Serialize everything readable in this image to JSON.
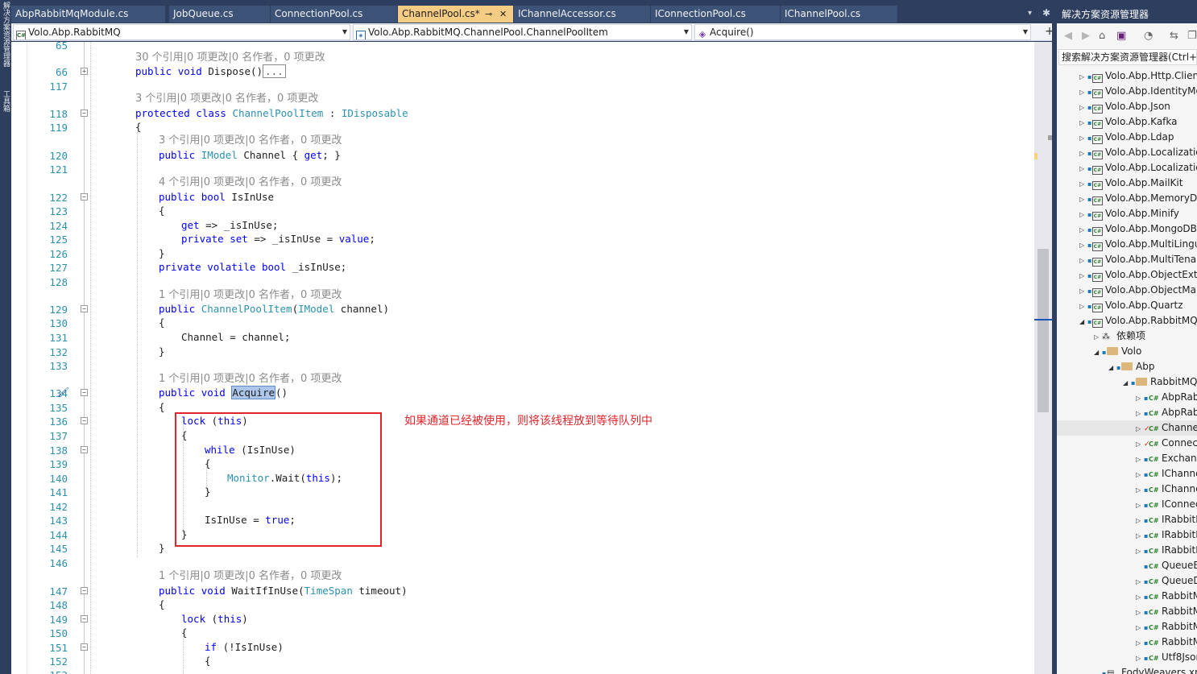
{
  "left_strip": {
    "labels": [
      "解决方案资源管理器",
      "工具箱"
    ]
  },
  "tabs": [
    {
      "label": "AbpRabbitMqModule.cs"
    },
    {
      "label": "JobQueue.cs"
    },
    {
      "label": "ConnectionPool.cs"
    },
    {
      "label": "ChannelPool.cs*",
      "active": true,
      "pin": "⊸",
      "close": "✕"
    },
    {
      "label": "IChannelAccessor.cs"
    },
    {
      "label": "IConnectionPool.cs"
    },
    {
      "label": "IChannelPool.cs"
    }
  ],
  "tab_controls": {
    "dropdown_icon": "▾",
    "gear_icon": "✱"
  },
  "nav": {
    "project": "Volo.Abp.RabbitMQ",
    "type": "Volo.Abp.RabbitMQ.ChannelPool.ChannelPoolItem",
    "member": "Acquire()",
    "split_icon": "+"
  },
  "code_lens_template": "{n} 个引用|0 项更改|0 名作者，0 项更改",
  "line_numbers": [
    "65",
    "66",
    "117",
    "118",
    "119",
    "120",
    "121",
    "122",
    "123",
    "124",
    "125",
    "126",
    "127",
    "128",
    "129",
    "130",
    "131",
    "132",
    "133",
    "134",
    "135",
    "136",
    "137",
    "138",
    "139",
    "140",
    "141",
    "142",
    "143",
    "144",
    "145",
    "146",
    "147",
    "148",
    "149",
    "150",
    "151",
    "152",
    "153"
  ],
  "code": {
    "lens_30": "30 个引用|0 项更改|0 名作者，0 项更改",
    "lens_3": "3 个引用|0 项更改|0 名作者，0 项更改",
    "lens_3b": "3 个引用|0 项更改|0 名作者，0 项更改",
    "lens_4": "4 个引用|0 项更改|0 名作者，0 项更改",
    "lens_1a": "1 个引用|0 项更改|0 名作者，0 项更改",
    "lens_1b": "1 个引用|0 项更改|0 名作者，0 项更改",
    "lens_1c": "1 个引用|0 项更改|0 名作者，0 项更改",
    "dispose_collapsed": "...",
    "acquire_name": "Acquire"
  },
  "annotation": "如果通道已经被使用，则将该线程放到等待队列中",
  "colors": {
    "keyword": "#0000ff",
    "type": "#2b91af",
    "annotation": "#e0262b",
    "active_tab": "#f5cc84",
    "chrome": "#2d3e5e"
  },
  "solution_explorer": {
    "title": "解决方案资源管理器",
    "search_placeholder": "搜索解决方案资源管理器(Ctrl+;)",
    "toolbar_icons": [
      "back-icon",
      "forward-icon",
      "home-icon",
      "vs-icon",
      "history-icon",
      "sync-icon",
      "copy-icon"
    ],
    "items": [
      {
        "label": "Volo.Abp.Http.Client",
        "kind": "project",
        "level": 0,
        "expanded": false
      },
      {
        "label": "Volo.Abp.IdentityModel",
        "kind": "project",
        "level": 0,
        "expanded": false
      },
      {
        "label": "Volo.Abp.Json",
        "kind": "project",
        "level": 0,
        "expanded": false
      },
      {
        "label": "Volo.Abp.Kafka",
        "kind": "project",
        "level": 0,
        "expanded": false
      },
      {
        "label": "Volo.Abp.Ldap",
        "kind": "project",
        "level": 0,
        "expanded": false
      },
      {
        "label": "Volo.Abp.Localization",
        "kind": "project",
        "level": 0,
        "expanded": false
      },
      {
        "label": "Volo.Abp.Localization.Abstractions",
        "kind": "project",
        "level": 0,
        "expanded": false
      },
      {
        "label": "Volo.Abp.MailKit",
        "kind": "project",
        "level": 0,
        "expanded": false
      },
      {
        "label": "Volo.Abp.MemoryDb",
        "kind": "project",
        "level": 0,
        "expanded": false
      },
      {
        "label": "Volo.Abp.Minify",
        "kind": "project",
        "level": 0,
        "expanded": false
      },
      {
        "label": "Volo.Abp.MongoDB",
        "kind": "project",
        "level": 0,
        "expanded": false
      },
      {
        "label": "Volo.Abp.MultiLingualObjects",
        "kind": "project",
        "level": 0,
        "expanded": false
      },
      {
        "label": "Volo.Abp.MultiTenancy",
        "kind": "project",
        "level": 0,
        "expanded": false
      },
      {
        "label": "Volo.Abp.ObjectExtending",
        "kind": "project",
        "level": 0,
        "expanded": false
      },
      {
        "label": "Volo.Abp.ObjectMapping",
        "kind": "project",
        "level": 0,
        "expanded": false
      },
      {
        "label": "Volo.Abp.Quartz",
        "kind": "project",
        "level": 0,
        "expanded": false
      },
      {
        "label": "Volo.Abp.RabbitMQ",
        "kind": "project",
        "level": 0,
        "expanded": true
      },
      {
        "label": "依赖项",
        "kind": "deps",
        "level": 1,
        "expanded": false
      },
      {
        "label": "Volo",
        "kind": "folder",
        "level": 1,
        "expanded": true
      },
      {
        "label": "Abp",
        "kind": "folder",
        "level": 2,
        "expanded": true
      },
      {
        "label": "RabbitMQ",
        "kind": "folder",
        "level": 3,
        "expanded": true
      },
      {
        "label": "AbpRabbitMqEventBusOptions.cs",
        "kind": "cs",
        "level": 4,
        "expanded": false
      },
      {
        "label": "AbpRabbitMqModule.cs",
        "kind": "cs",
        "level": 4,
        "expanded": false
      },
      {
        "label": "ChannelPool.cs",
        "kind": "cs",
        "level": 4,
        "expanded": false,
        "modified": true,
        "selected": true
      },
      {
        "label": "ConnectionPool.cs",
        "kind": "cs",
        "level": 4,
        "expanded": false,
        "modified": true
      },
      {
        "label": "ExchangeDeclareConfiguration.cs",
        "kind": "cs",
        "level": 4,
        "expanded": false
      },
      {
        "label": "IChannelAccessor.cs",
        "kind": "cs",
        "level": 4,
        "expanded": false
      },
      {
        "label": "IChannelPool.cs",
        "kind": "cs",
        "level": 4,
        "expanded": false
      },
      {
        "label": "IConnectionPool.cs",
        "kind": "cs",
        "level": 4,
        "expanded": false
      },
      {
        "label": "IRabbitMqMessageConsumer.cs",
        "kind": "cs",
        "level": 4,
        "expanded": false
      },
      {
        "label": "IRabbitMqMessageConsumerFactory.cs",
        "kind": "cs",
        "level": 4,
        "expanded": false
      },
      {
        "label": "IRabbitMqSerializer.cs",
        "kind": "cs",
        "level": 4,
        "expanded": false
      },
      {
        "label": "QueueBindCommand.cs",
        "kind": "cs",
        "level": 4,
        "expanded": null
      },
      {
        "label": "QueueDeclareConfiguration.cs",
        "kind": "cs",
        "level": 4,
        "expanded": false
      },
      {
        "label": "RabbitMqConnections.cs",
        "kind": "cs",
        "level": 4,
        "expanded": false
      },
      {
        "label": "RabbitMqMessageConsumer.cs",
        "kind": "cs",
        "level": 4,
        "expanded": false
      },
      {
        "label": "RabbitMqMessageConsumerFactory.cs",
        "kind": "cs",
        "level": 4,
        "expanded": false
      },
      {
        "label": "RabbitMqSerializer.cs",
        "kind": "cs",
        "level": 4,
        "expanded": false
      },
      {
        "label": "Utf8JsonRabbitMqSerializer.cs",
        "kind": "cs",
        "level": 4,
        "expanded": false
      },
      {
        "label": "FodyWeavers.xml",
        "kind": "file",
        "level": 1,
        "expanded": null
      }
    ]
  }
}
